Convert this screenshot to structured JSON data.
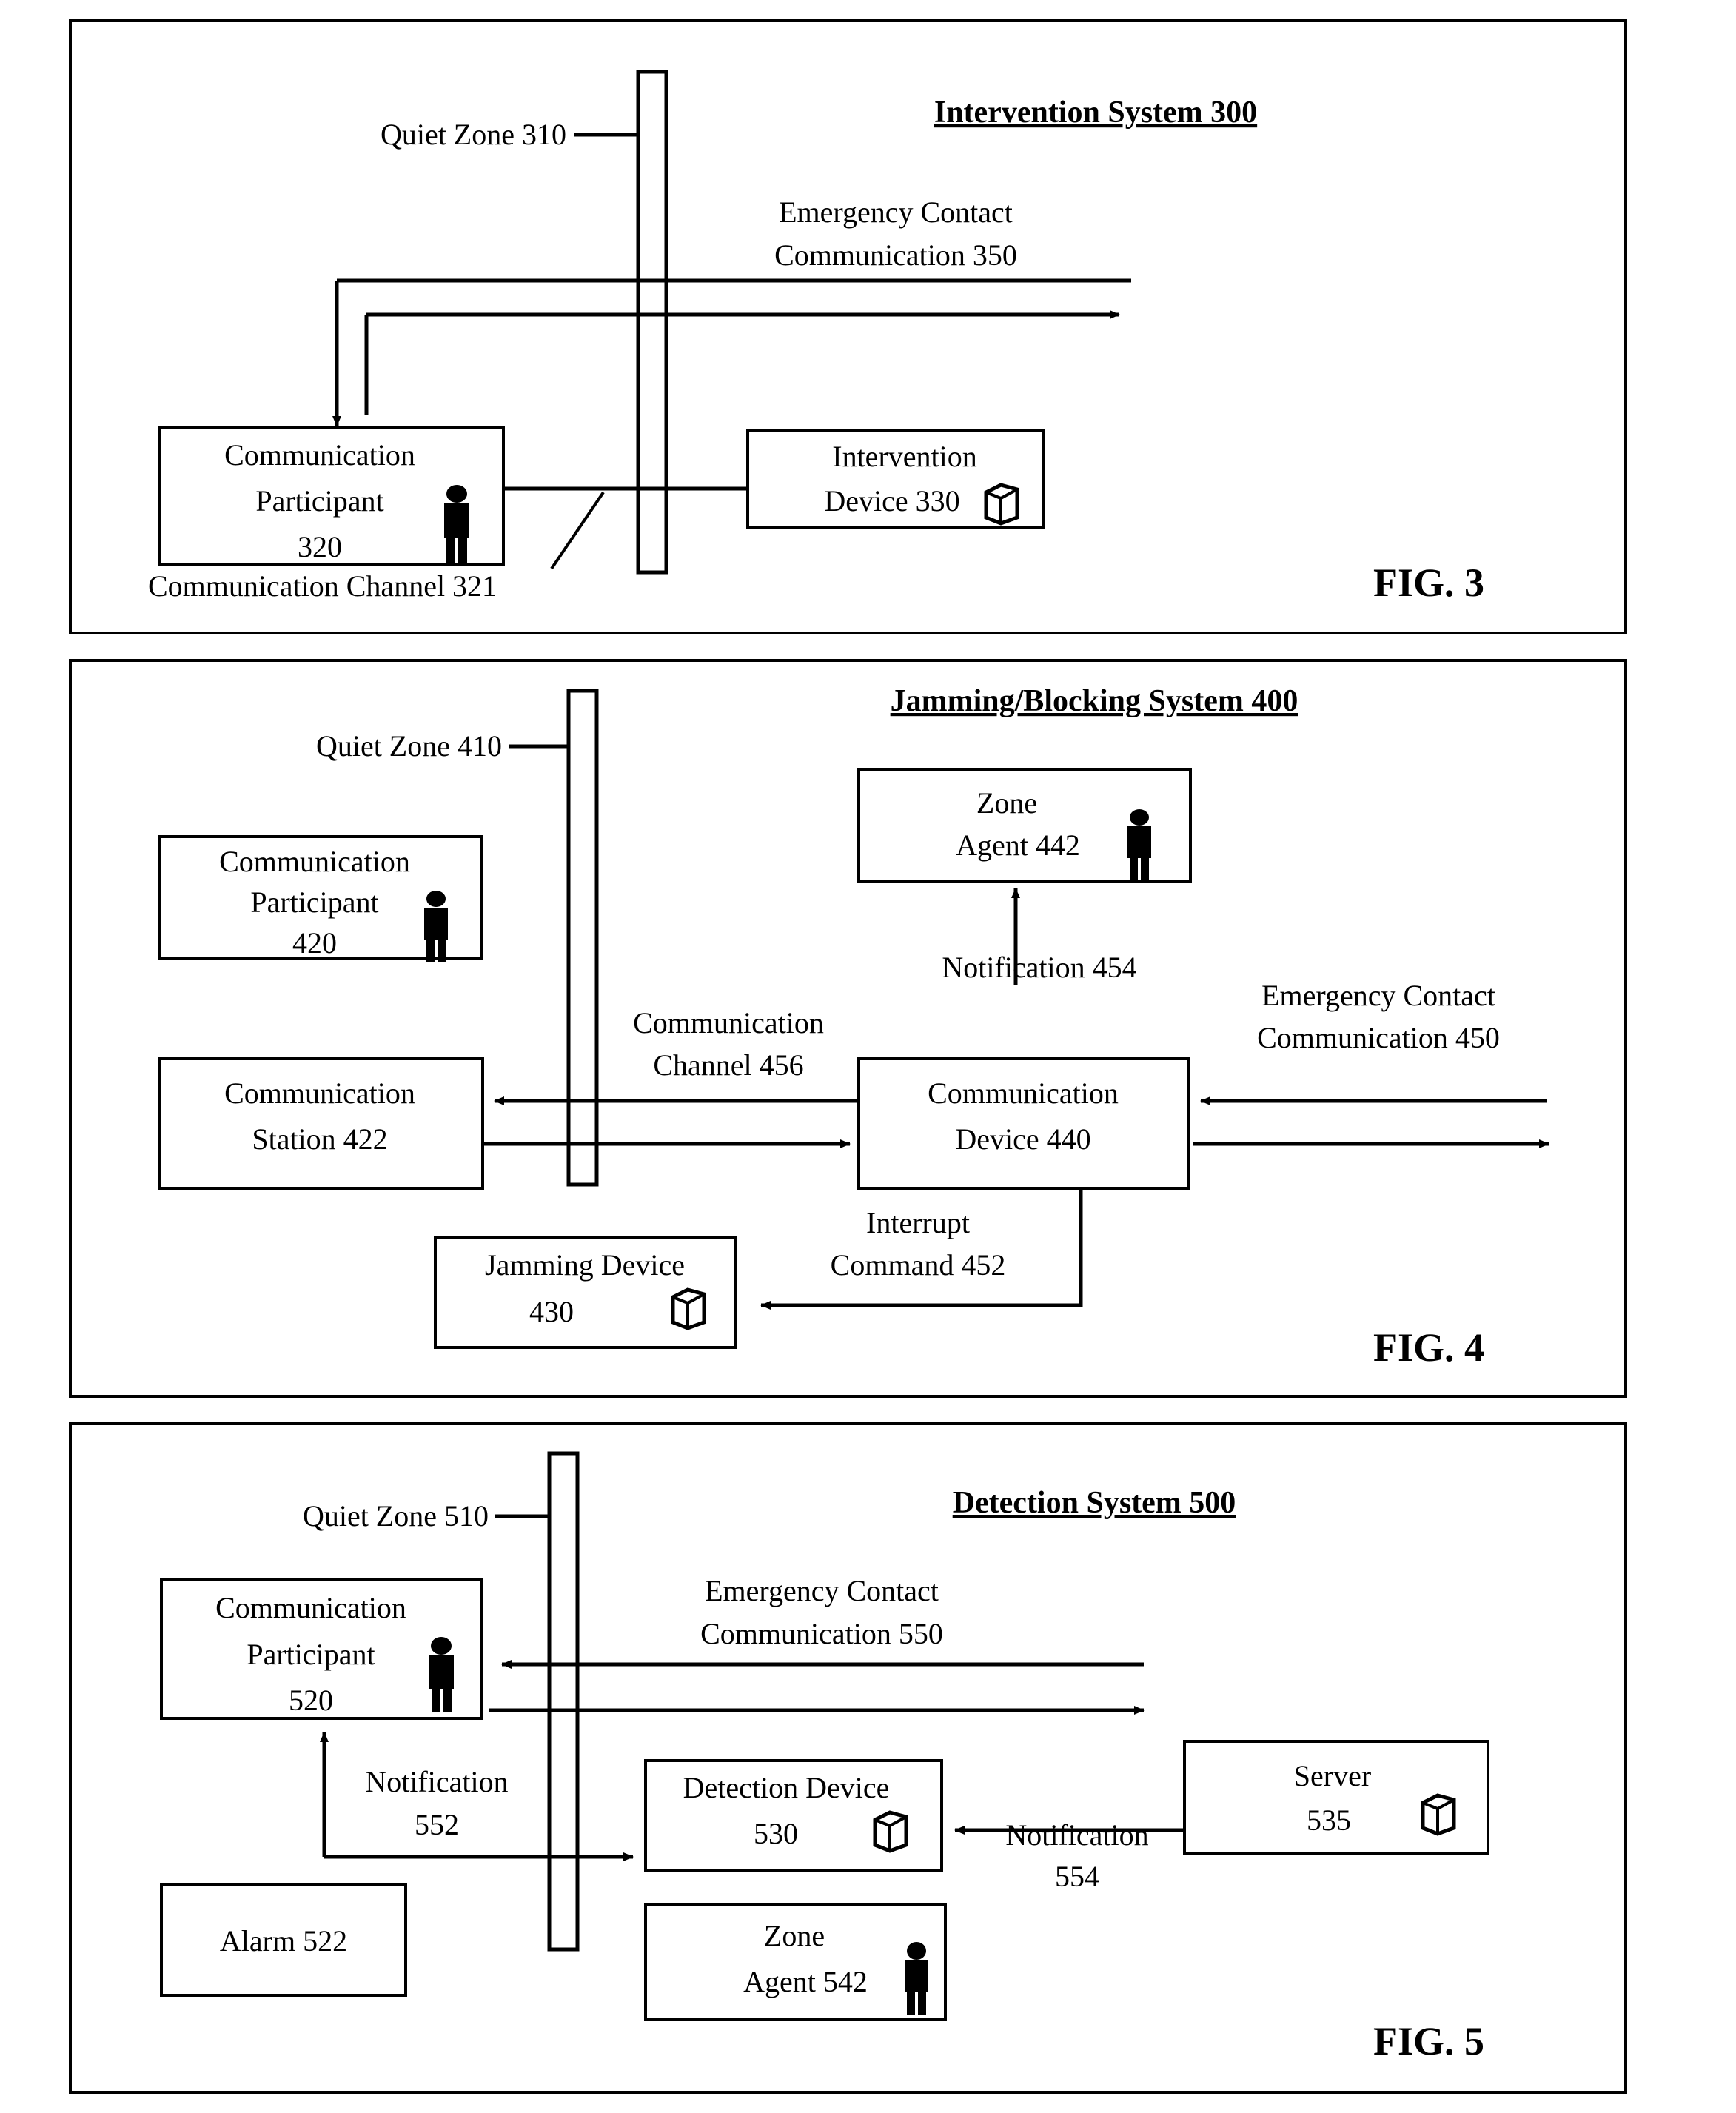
{
  "figures": [
    {
      "id": "fig3",
      "fig_label": "FIG. 3",
      "title": "Intervention System 300",
      "zone_label": "Quiet Zone 310",
      "boxes": [
        {
          "name": "communication-participant-320",
          "lines": [
            "Communication",
            "Participant",
            "320"
          ],
          "icon": "person-icon"
        },
        {
          "name": "intervention-device-330",
          "lines": [
            "Intervention",
            "Device 330"
          ],
          "icon": "device-cube-icon"
        }
      ],
      "flow_labels": [
        {
          "name": "emergency-contact-communication-350",
          "lines": [
            "Emergency Contact",
            "Communication 350"
          ]
        },
        {
          "name": "communication-channel-321",
          "lines": [
            "Communication Channel 321"
          ]
        }
      ]
    },
    {
      "id": "fig4",
      "fig_label": "FIG. 4",
      "title": "Jamming/Blocking System 400",
      "zone_label": "Quiet Zone 410",
      "boxes": [
        {
          "name": "communication-participant-420",
          "lines": [
            "Communication",
            "Participant",
            "420"
          ],
          "icon": "person-icon"
        },
        {
          "name": "zone-agent-442",
          "lines": [
            "Zone",
            "Agent 442"
          ],
          "icon": "person-icon"
        },
        {
          "name": "communication-station-422",
          "lines": [
            "Communication",
            "Station 422"
          ],
          "icon": "none"
        },
        {
          "name": "communication-device-440",
          "lines": [
            "Communication",
            "Device 440"
          ],
          "icon": "none"
        },
        {
          "name": "jamming-device-430",
          "lines": [
            "Jamming Device",
            "430"
          ],
          "icon": "device-cube-icon"
        }
      ],
      "flow_labels": [
        {
          "name": "notification-454",
          "lines": [
            "Notification 454"
          ]
        },
        {
          "name": "communication-channel-456",
          "lines": [
            "Communication",
            "Channel 456"
          ]
        },
        {
          "name": "emergency-contact-communication-450",
          "lines": [
            "Emergency Contact",
            "Communication 450"
          ]
        },
        {
          "name": "interrupt-command-452",
          "lines": [
            "Interrupt",
            "Command 452"
          ]
        }
      ]
    },
    {
      "id": "fig5",
      "fig_label": "FIG. 5",
      "title": "Detection System 500",
      "zone_label": "Quiet Zone 510",
      "boxes": [
        {
          "name": "communication-participant-520",
          "lines": [
            "Communication",
            "Participant",
            "520"
          ],
          "icon": "person-icon"
        },
        {
          "name": "detection-device-530",
          "lines": [
            "Detection Device",
            "530"
          ],
          "icon": "device-cube-icon"
        },
        {
          "name": "server-535",
          "lines": [
            "Server",
            "535"
          ],
          "icon": "device-cube-icon"
        },
        {
          "name": "alarm-522",
          "lines": [
            "Alarm 522"
          ],
          "icon": "none"
        },
        {
          "name": "zone-agent-542",
          "lines": [
            "Zone",
            "Agent 542"
          ],
          "icon": "person-icon"
        }
      ],
      "flow_labels": [
        {
          "name": "emergency-contact-communication-550",
          "lines": [
            "Emergency Contact",
            "Communication 550"
          ]
        },
        {
          "name": "notification-552",
          "lines": [
            "Notification",
            "552"
          ]
        },
        {
          "name": "notification-554",
          "lines": [
            "Notification",
            "554"
          ]
        }
      ]
    }
  ]
}
